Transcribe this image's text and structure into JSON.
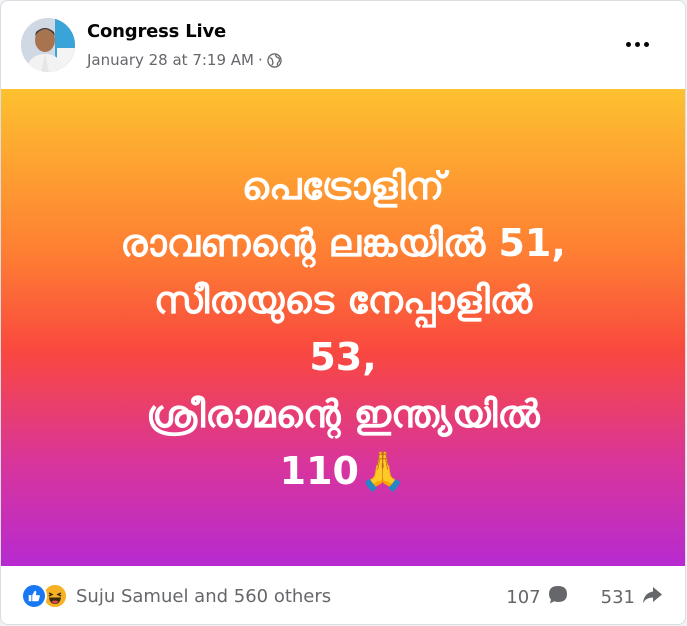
{
  "post": {
    "author": "Congress Live",
    "timestamp": "January 28 at 7:19 AM",
    "separator": "·",
    "audience_icon": "globe-icon",
    "more_icon": "more-options-icon",
    "text": "പെട്രോളിന്\nരാവണന്റെ ലങ്കയിൽ 51,\nസീതയുടെ നേപ്പാളിൽ\n53,\nശ്രീരാമന്റെ ഇന്ത്യയിൽ\n110🙏",
    "background_colors": [
      "#fdc12f",
      "#fe7d33",
      "#f9483f",
      "#d9359a",
      "#b62ad0"
    ]
  },
  "footer": {
    "reactions_label": "Suju Samuel and 560 others",
    "reaction_icons": [
      "like-icon",
      "haha-icon"
    ],
    "comments_count": "107",
    "shares_count": "531",
    "comment_icon": "comment-icon",
    "share_icon": "share-icon"
  },
  "colors": {
    "like": "#1877f2",
    "haha": "#f7b125",
    "secondary_text": "#65676b"
  }
}
